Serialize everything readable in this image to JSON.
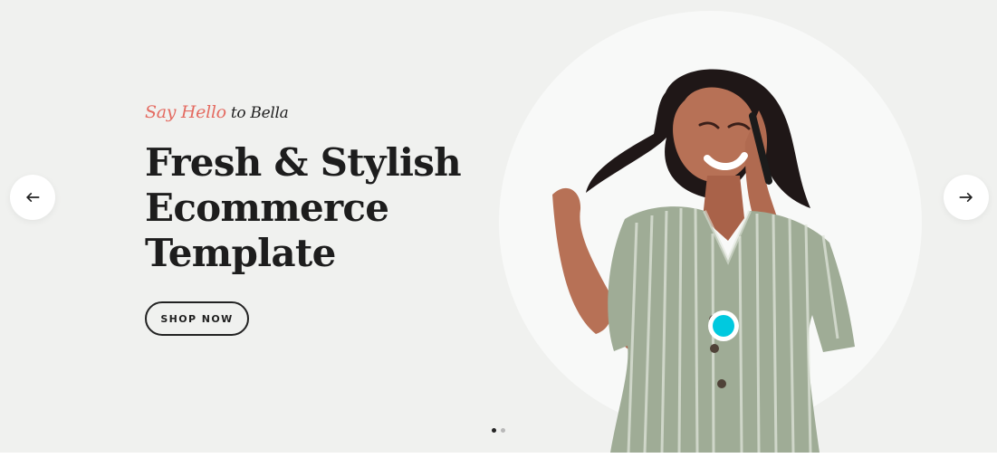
{
  "hero": {
    "eyebrow": {
      "accent": "Say Hello",
      "dark": "to Bella"
    },
    "headline": {
      "line1": "Fresh & Stylish",
      "line2": "Ecommerce",
      "line3": "Template"
    },
    "button_label": "SHOP NOW"
  },
  "slider": {
    "active_slide": 1,
    "slides_count": 2
  },
  "colors": {
    "accent": "#e46b61",
    "text": "#1d1d1d",
    "background": "#f0f1ef",
    "circle": "#f8f9f8",
    "marker": "#00c9df"
  },
  "icons": {
    "previous": "arrow-left-icon",
    "next": "arrow-right-icon"
  }
}
